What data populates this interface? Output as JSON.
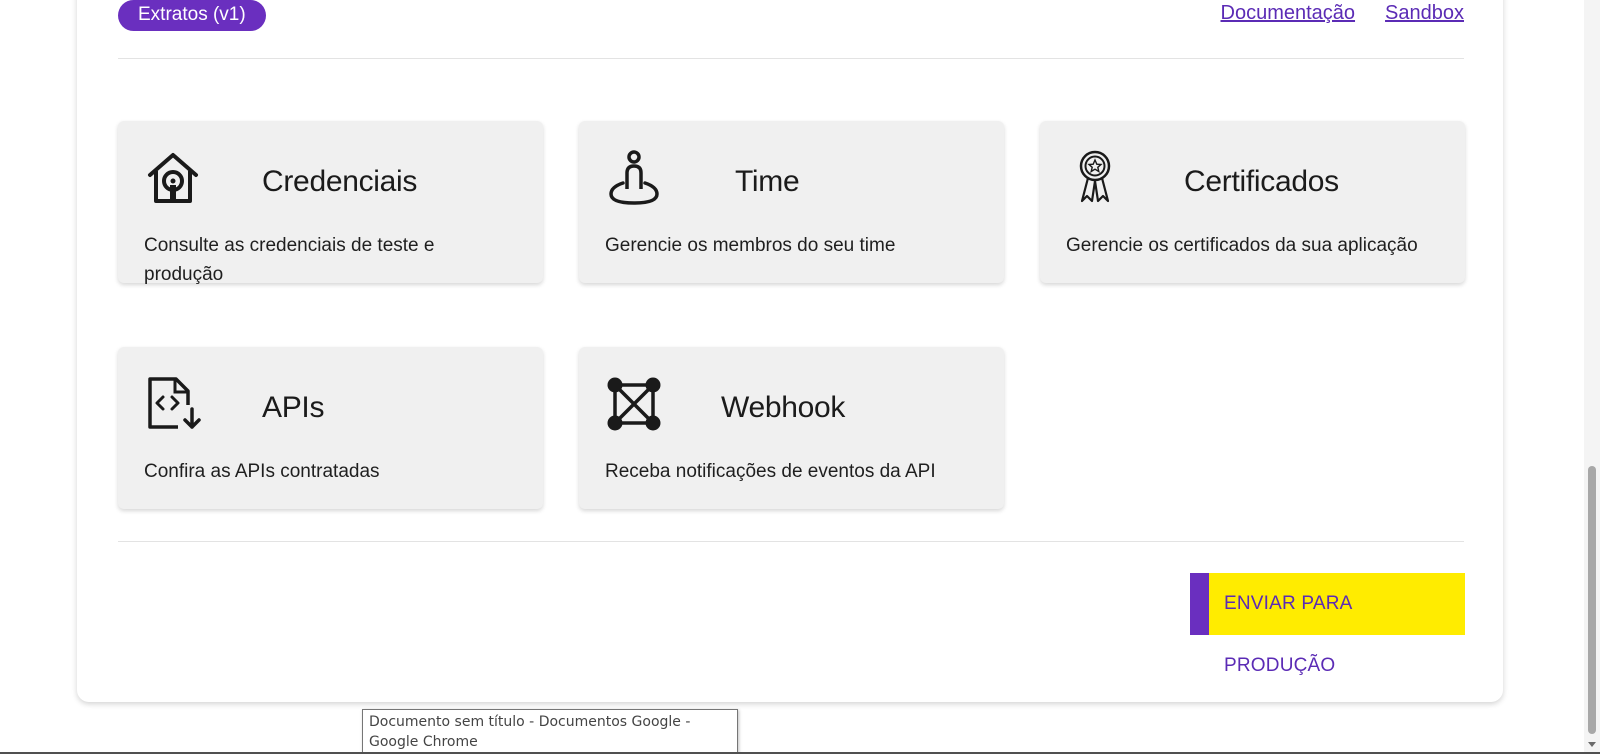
{
  "header": {
    "badge_label": "Extratos (v1)",
    "links": {
      "documentation": "Documentação",
      "sandbox": "Sandbox"
    }
  },
  "cards": [
    {
      "title": "Credenciais",
      "description": "Consulte as credenciais de teste e produção",
      "icon": "house-lock-icon"
    },
    {
      "title": "Time",
      "description": "Gerencie os membros do seu time",
      "icon": "person-location-icon"
    },
    {
      "title": "Certificados",
      "description": "Gerencie os certificados da sua aplicação",
      "icon": "award-ribbon-icon"
    },
    {
      "title": "APIs",
      "description": "Confira as APIs contratadas",
      "icon": "code-file-download-icon"
    },
    {
      "title": "Webhook",
      "description": "Receba notificações de eventos da API",
      "icon": "network-nodes-icon"
    }
  ],
  "actions": {
    "send_to_production": "ENVIAR PARA PRODUÇÃO"
  },
  "tooltip": {
    "text": "Documento sem título - Documentos Google - Google Chrome"
  },
  "colors": {
    "brand_purple": "#6a2fbf",
    "link_purple": "#5b2bb5",
    "accent_yellow": "#ffec00",
    "card_bg": "#f0f0f0"
  }
}
